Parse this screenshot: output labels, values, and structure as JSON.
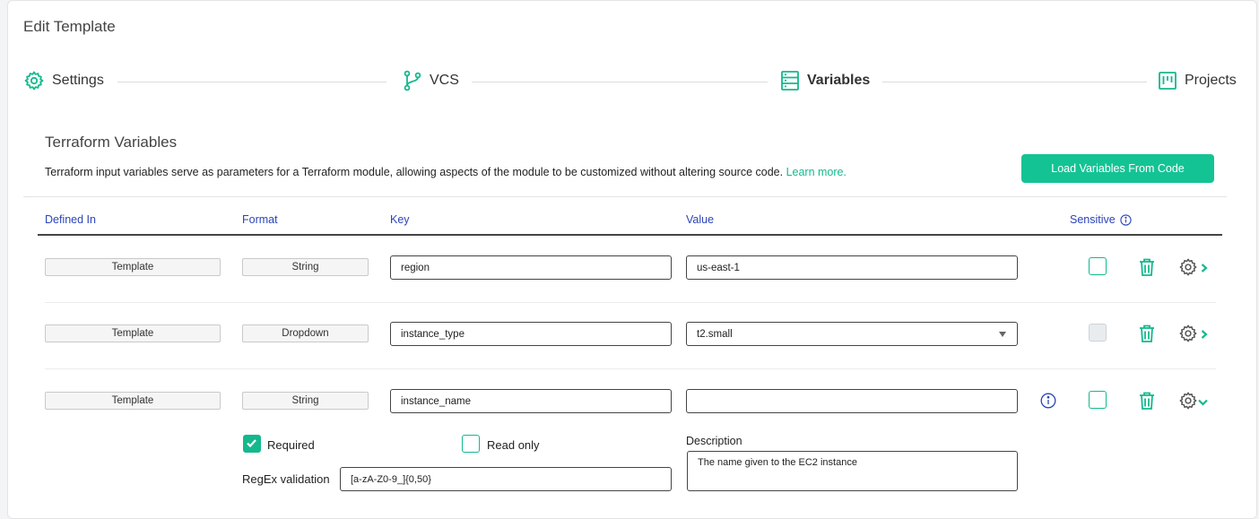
{
  "page": {
    "title": "Edit Template"
  },
  "stepper": {
    "settings": "Settings",
    "vcs": "VCS",
    "variables": "Variables",
    "projects": "Projects"
  },
  "section": {
    "title": "Terraform Variables",
    "description": "Terraform input variables serve as parameters for a Terraform module, allowing aspects of the module to be customized without altering source code.",
    "learn_more": "Learn more.",
    "load_button": "Load Variables From Code"
  },
  "table": {
    "headers": {
      "defined_in": "Defined In",
      "format": "Format",
      "key": "Key",
      "value": "Value",
      "sensitive": "Sensitive"
    },
    "rows": [
      {
        "defined_in": "Template",
        "format": "String",
        "key": "region",
        "value": "us-east-1",
        "sensitive": false,
        "sensitive_enabled": true
      },
      {
        "defined_in": "Template",
        "format": "Dropdown",
        "key": "instance_type",
        "value": "t2.small",
        "sensitive": false,
        "sensitive_enabled": false
      },
      {
        "defined_in": "Template",
        "format": "String",
        "key": "instance_name",
        "value": "",
        "sensitive": false,
        "sensitive_enabled": true
      }
    ]
  },
  "expanded": {
    "required_label": "Required",
    "required_checked": true,
    "readonly_label": "Read only",
    "readonly_checked": false,
    "description_label": "Description",
    "description_value": "The name given to the EC2 instance",
    "regex_label": "RegEx validation",
    "regex_value": "[a-zA-Z0-9_]{0,50}"
  },
  "colors": {
    "accent": "#14c394",
    "header_text": "#2b44b8"
  }
}
